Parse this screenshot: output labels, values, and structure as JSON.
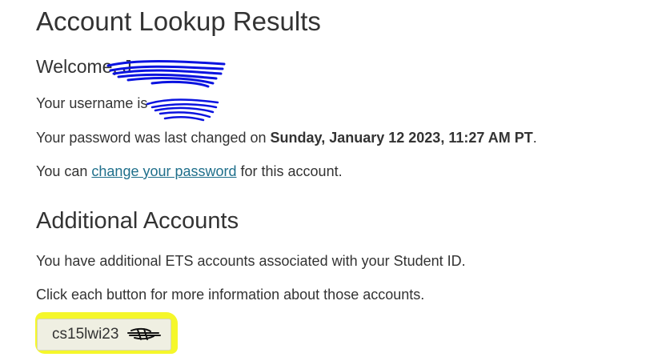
{
  "page": {
    "title": "Account Lookup Results"
  },
  "account": {
    "welcome_prefix": "Welcome, ",
    "welcome_name": "J",
    "username_prefix": "Your username is ",
    "password_prefix": "Your password was last changed on ",
    "password_changed": "Sunday, January 12 2023, 11:27 AM PT",
    "password_suffix": ".",
    "change_prefix": "You can ",
    "change_link": "change your password",
    "change_suffix": " for this account."
  },
  "additional": {
    "heading": "Additional Accounts",
    "intro": "You have additional ETS accounts associated with your Student ID.",
    "instruction": "Click each button for more information about those accounts.",
    "buttons": [
      {
        "label": "cs15lwi23"
      }
    ]
  },
  "colors": {
    "link": "#1f6f8b",
    "redaction_ink": "#0a13e0",
    "highlight": "#f5f72a"
  }
}
